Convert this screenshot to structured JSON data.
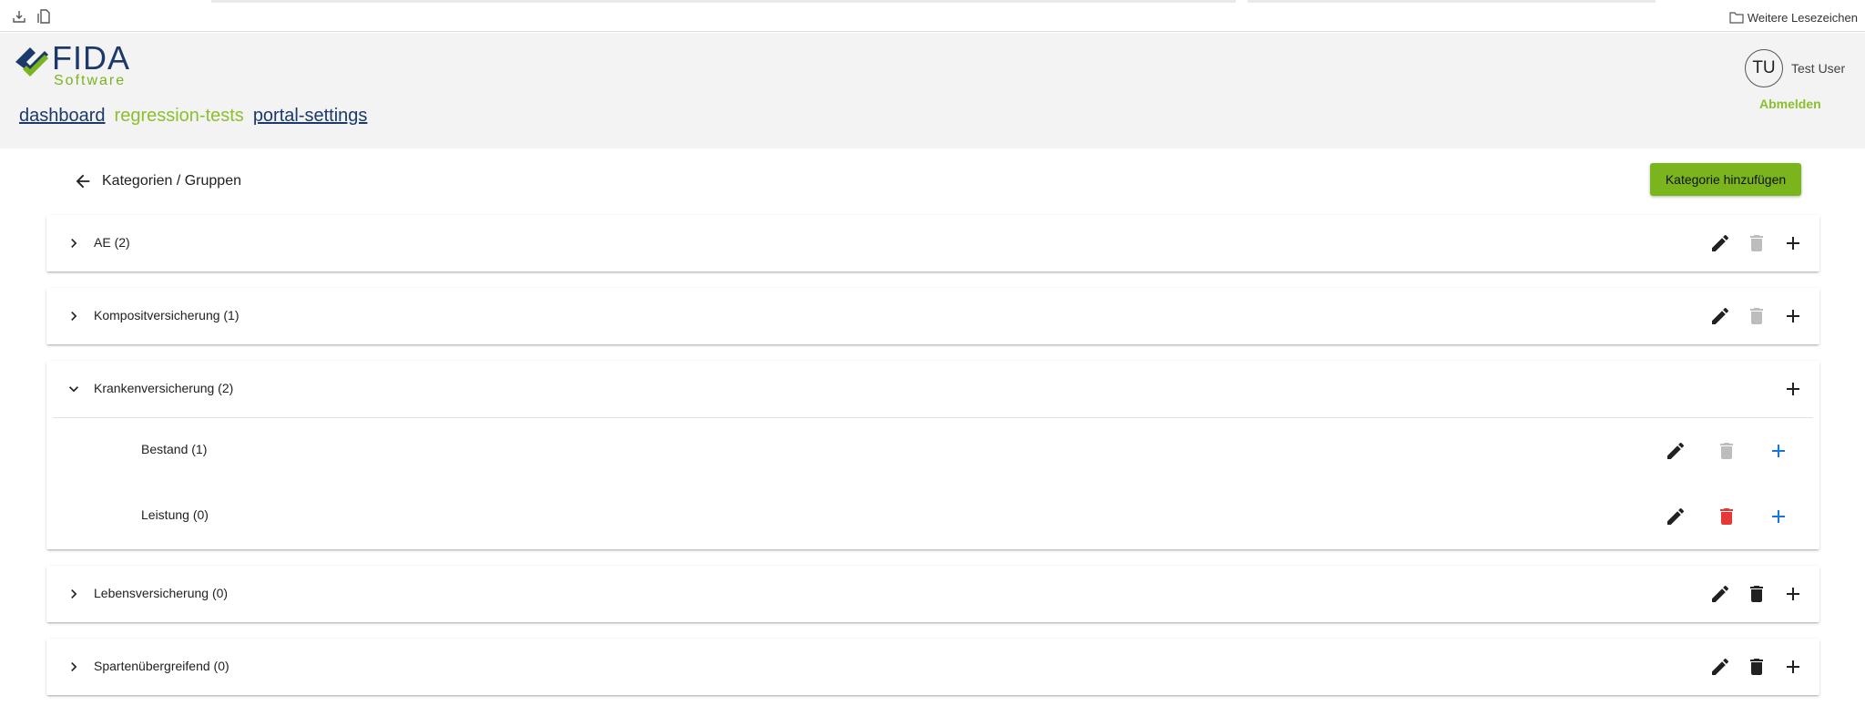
{
  "browser": {
    "bookmarks_folder_label": "Weitere Lesezeichen"
  },
  "brand": {
    "logo_main": "FIDA",
    "logo_sub": "Software",
    "colors": {
      "navy": "#1b3a6b",
      "green": "#7ab51d",
      "danger": "#e53935",
      "primary_blue": "#1976d2",
      "disabled": "#bdbdbd"
    }
  },
  "nav": {
    "items": [
      {
        "label": "dashboard",
        "state": "link"
      },
      {
        "label": "regression-tests",
        "state": "active"
      },
      {
        "label": "portal-settings",
        "state": "link"
      }
    ]
  },
  "user": {
    "initials": "TU",
    "name": "Test User",
    "logout_label": "Abmelden"
  },
  "page": {
    "title": "Kategorien / Gruppen",
    "back_icon": "arrow-left-icon",
    "add_category_label": "Kategorie hinzufügen"
  },
  "categories": [
    {
      "label": "AE (2)",
      "expanded": false,
      "delete_enabled": false
    },
    {
      "label": "Kompositversicherung (1)",
      "expanded": false,
      "delete_enabled": false
    },
    {
      "label": "Krankenversicherung (2)",
      "expanded": true,
      "delete_enabled": false,
      "groups": [
        {
          "label": "Bestand (1)",
          "delete_enabled": false
        },
        {
          "label": "Leistung (0)",
          "delete_enabled": true
        }
      ]
    },
    {
      "label": "Lebensversicherung (0)",
      "expanded": false,
      "delete_enabled": true
    },
    {
      "label": "Spartenübergreifend (0)",
      "expanded": false,
      "delete_enabled": true
    }
  ]
}
